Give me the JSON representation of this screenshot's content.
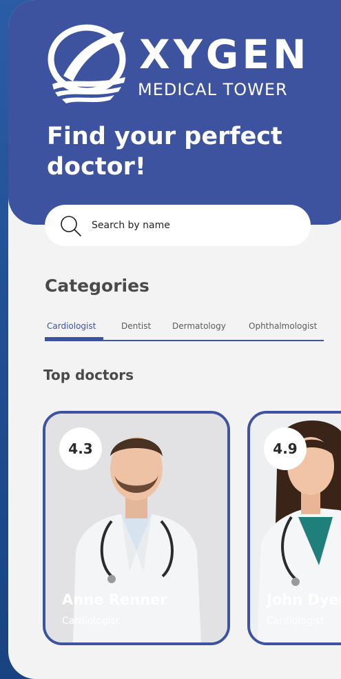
{
  "brand": {
    "word": "XYGEN",
    "subtitle": "MEDICAL TOWER",
    "primary_color": "#3d53a0"
  },
  "hero": {
    "title": "Find your perfect doctor!"
  },
  "search": {
    "placeholder": "Search by name",
    "icon": "search-icon"
  },
  "categories": {
    "title": "Categories",
    "tabs": [
      {
        "label": "Cardiologist",
        "active": true
      },
      {
        "label": "Dentist",
        "active": false
      },
      {
        "label": "Dermatology",
        "active": false
      },
      {
        "label": "Ophthalmologist",
        "active": false
      }
    ]
  },
  "top_doctors": {
    "title": "Top doctors",
    "doctors": [
      {
        "name": "Anne Renner",
        "specialty": "Cardiologist",
        "rating": "4.3"
      },
      {
        "name": "John Dyer",
        "specialty": "Cardiologist",
        "rating": "4.9"
      }
    ]
  }
}
